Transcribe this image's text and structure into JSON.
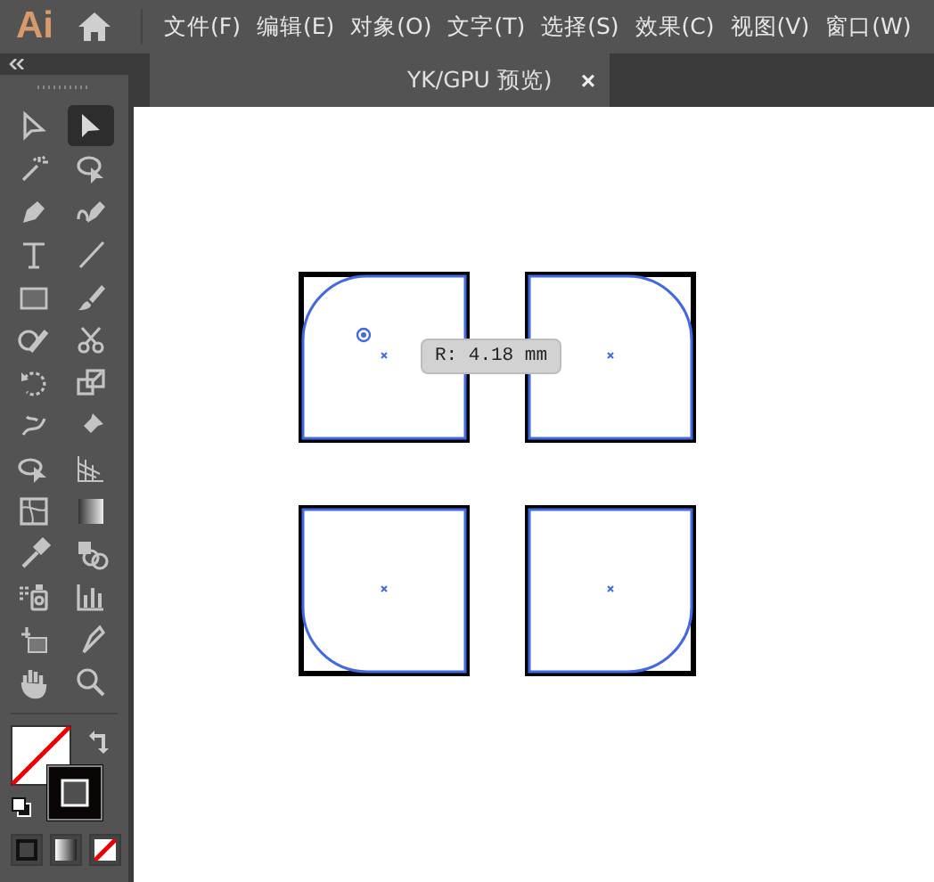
{
  "app": {
    "logo": "Ai"
  },
  "menu": [
    "文件(F)",
    "编辑(E)",
    "对象(O)",
    "文字(T)",
    "选择(S)",
    "效果(C)",
    "视图(V)",
    "窗口(W)"
  ],
  "document_tab": {
    "title": "YK/GPU 预览)",
    "close": "×"
  },
  "tools": [
    {
      "kind": "direct-select",
      "selected": false
    },
    {
      "kind": "select",
      "selected": true
    },
    {
      "kind": "wand",
      "selected": false
    },
    {
      "kind": "lasso",
      "selected": false
    },
    {
      "kind": "pen",
      "selected": false
    },
    {
      "kind": "curvature",
      "selected": false
    },
    {
      "kind": "type",
      "selected": false
    },
    {
      "kind": "line",
      "selected": false
    },
    {
      "kind": "rect",
      "selected": false
    },
    {
      "kind": "brush",
      "selected": false
    },
    {
      "kind": "shaper",
      "selected": false
    },
    {
      "kind": "scissors",
      "selected": false
    },
    {
      "kind": "rotate",
      "selected": false
    },
    {
      "kind": "scale",
      "selected": false
    },
    {
      "kind": "puppet",
      "selected": false
    },
    {
      "kind": "pin",
      "selected": false
    },
    {
      "kind": "free-transform",
      "selected": false
    },
    {
      "kind": "perspective",
      "selected": false
    },
    {
      "kind": "mesh",
      "selected": false
    },
    {
      "kind": "gradient",
      "selected": false
    },
    {
      "kind": "eyedropper",
      "selected": false
    },
    {
      "kind": "blend",
      "selected": false
    },
    {
      "kind": "sprayer",
      "selected": false
    },
    {
      "kind": "graph",
      "selected": false
    },
    {
      "kind": "artboard",
      "selected": false
    },
    {
      "kind": "slice",
      "selected": false
    },
    {
      "kind": "hand",
      "selected": false
    },
    {
      "kind": "zoom",
      "selected": false
    }
  ],
  "canvas": {
    "shapes": [
      {
        "kind": "topleft"
      },
      {
        "kind": "topright"
      },
      {
        "kind": "bottomleft"
      },
      {
        "kind": "bottomright"
      }
    ],
    "tooltip": "R: 4.18 mm"
  }
}
